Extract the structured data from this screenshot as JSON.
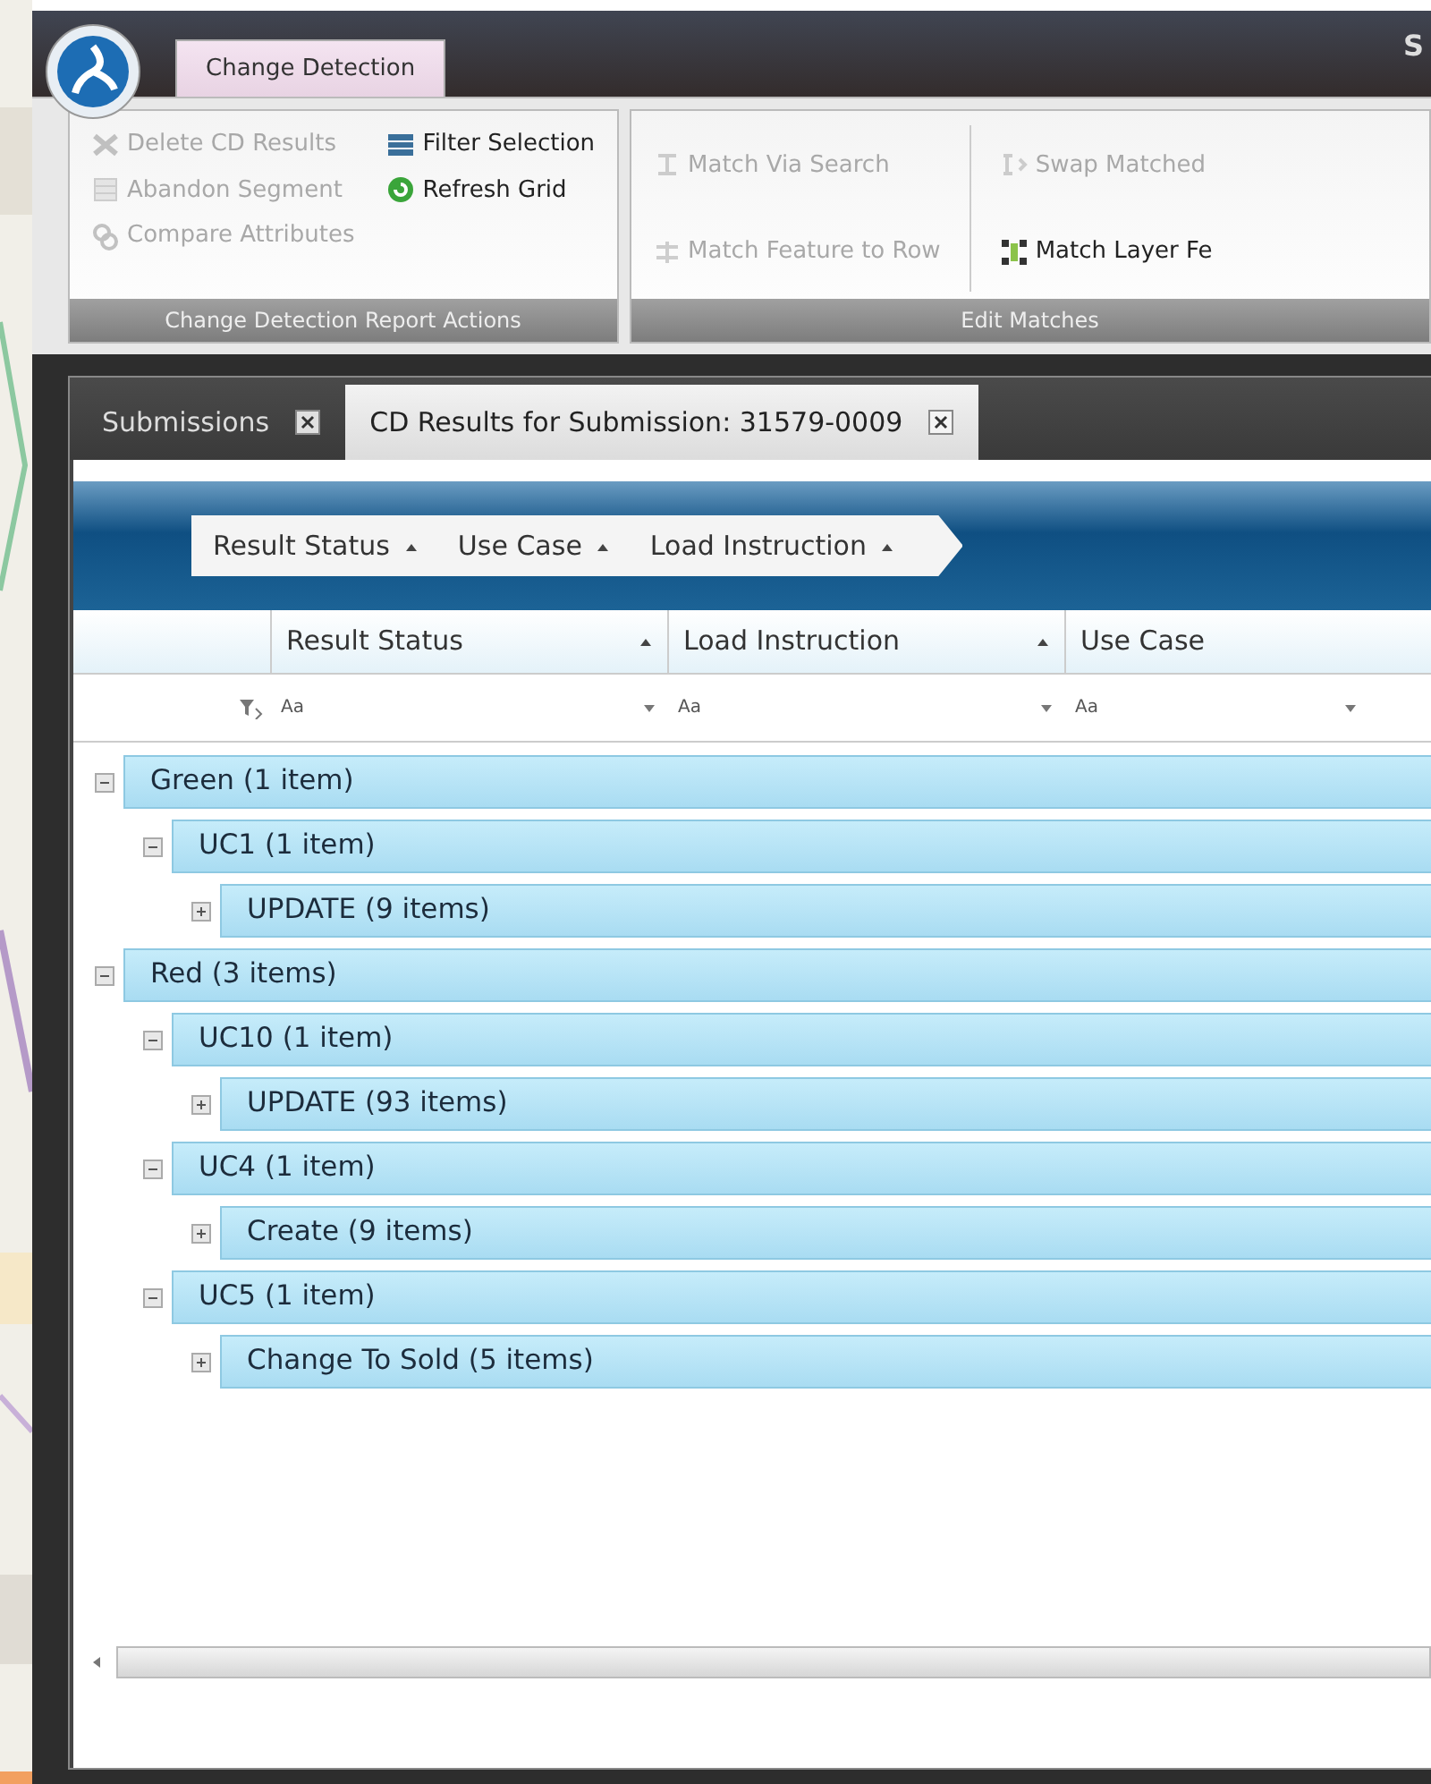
{
  "title_bar": {
    "title": "S"
  },
  "ribbon": {
    "tabs": [
      {
        "label": "Change Detection",
        "selected": true
      }
    ],
    "groups": [
      {
        "label": "Change Detection Report Actions",
        "columns": [
          [
            {
              "label": "Delete CD Results",
              "disabled": true
            },
            {
              "label": "Abandon Segment",
              "disabled": true
            },
            {
              "label": "Compare Attributes",
              "disabled": true
            }
          ],
          [
            {
              "label": "Filter Selection",
              "disabled": false
            },
            {
              "label": "Refresh Grid",
              "disabled": false
            }
          ]
        ]
      },
      {
        "label": "Edit Matches",
        "columns": [
          [
            {
              "label": "Match Via Search",
              "disabled": true
            },
            {
              "label": "Match Feature to Row",
              "disabled": true
            }
          ],
          [
            {
              "label": "Swap Matched",
              "disabled": true
            },
            {
              "label": "Match Layer Fe",
              "disabled": false
            }
          ]
        ]
      }
    ]
  },
  "document_tabs": [
    {
      "label": "Submissions",
      "selected": false
    },
    {
      "label": "CD Results for Submission: 31579-0009",
      "selected": true
    }
  ],
  "grouping_panel": [
    "Result Status",
    "Use Case",
    "Load Instruction"
  ],
  "columns": [
    "Result Status",
    "Load Instruction",
    "Use Case"
  ],
  "filters": [
    "Aa",
    "Aa",
    "Aa"
  ],
  "tree": [
    {
      "label": "Green (1 item)",
      "expanded": true,
      "children": [
        {
          "label": "UC1 (1 item)",
          "expanded": true,
          "children": [
            {
              "label": "UPDATE (9 items)",
              "expanded": false
            }
          ]
        }
      ]
    },
    {
      "label": "Red (3 items)",
      "expanded": true,
      "children": [
        {
          "label": "UC10 (1 item)",
          "expanded": true,
          "children": [
            {
              "label": "UPDATE (93 items)",
              "expanded": false
            }
          ]
        },
        {
          "label": "UC4 (1 item)",
          "expanded": true,
          "children": [
            {
              "label": "Create (9 items)",
              "expanded": false
            }
          ]
        },
        {
          "label": "UC5 (1 item)",
          "expanded": true,
          "children": [
            {
              "label": "Change To Sold (5 items)",
              "expanded": false
            }
          ]
        }
      ]
    }
  ]
}
